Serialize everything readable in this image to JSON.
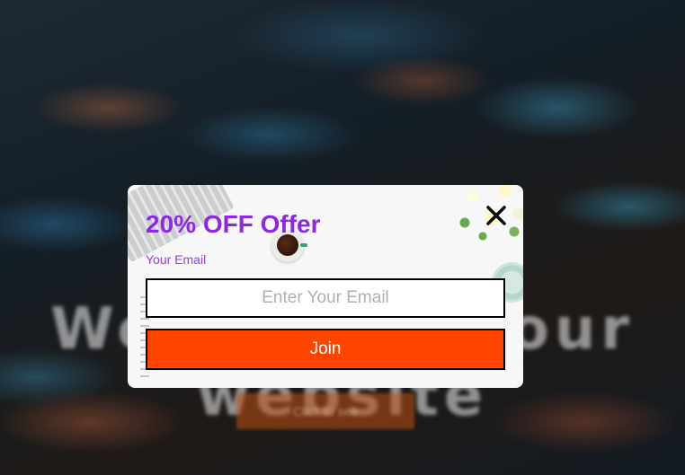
{
  "background": {
    "hero_title": "Welcome to our website",
    "hero_button_label": "Click to see"
  },
  "modal": {
    "title": "20% OFF Offer",
    "email_label": "Your Email",
    "email_value": "",
    "email_placeholder": "Enter Your Email",
    "join_label": "Join",
    "close_icon": "close-icon"
  },
  "colors": {
    "title": "#8a2be2",
    "label": "#9a3cf0",
    "join_button": "#ff4500",
    "join_text": "#ffffff",
    "input_border": "#000000"
  }
}
